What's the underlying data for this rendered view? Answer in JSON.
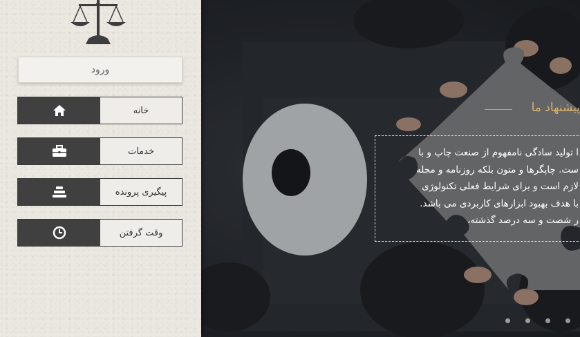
{
  "sidebar": {
    "login_label": "ورود",
    "nav": [
      {
        "label": "خانه",
        "icon": "home-icon"
      },
      {
        "label": "خدمات",
        "icon": "briefcase-icon"
      },
      {
        "label": "پیگیری پرونده",
        "icon": "stack-icon"
      },
      {
        "label": "وقت گرفتن",
        "icon": "clock-icon"
      }
    ]
  },
  "hero": {
    "title": "پیشنهاد ما",
    "lines": [
      "ا تولید سادگی نامفهوم از صنعت چاپ و با",
      "ست. چاپگرها و متون بلکه روزنامه و مجله",
      "لازم است و برای شرایط فعلی تکنولوژی",
      "با هدف بهبود ابزارهای کاربردی می باشد.",
      "ر شصت و سه درصد گذشته،"
    ],
    "slide_count": 4
  },
  "colors": {
    "accent": "#d9b36e",
    "sidebar_bg": "#ebe7e1",
    "button_dark": "#404040"
  }
}
